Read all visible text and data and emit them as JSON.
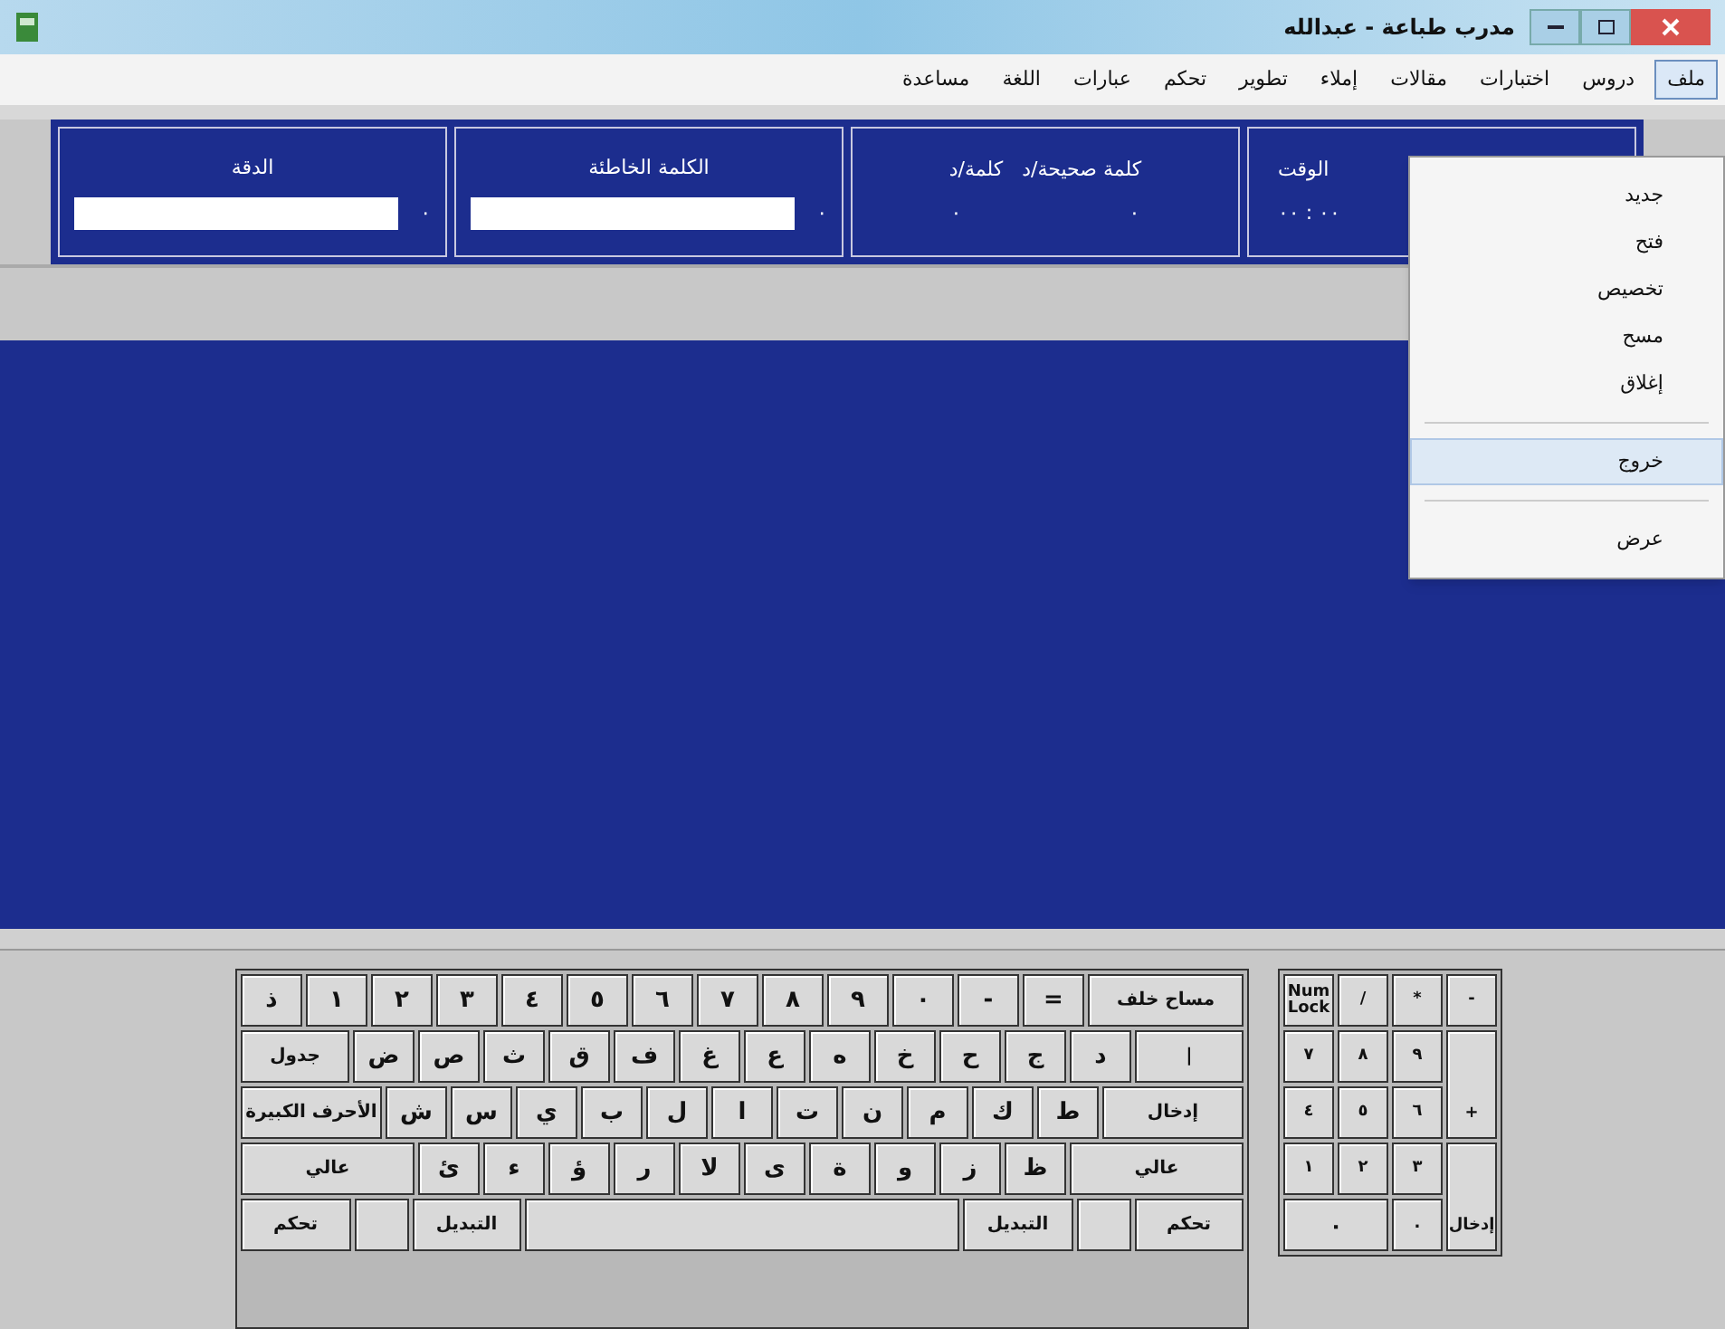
{
  "window": {
    "title": "مدرب طباعة - عبدالله"
  },
  "menu": [
    {
      "label": "ملف",
      "selected": true
    },
    {
      "label": "دروس",
      "selected": false
    },
    {
      "label": "اختبارات",
      "selected": false
    },
    {
      "label": "مقالات",
      "selected": false
    },
    {
      "label": "إملاء",
      "selected": false
    },
    {
      "label": "تطوير",
      "selected": false
    },
    {
      "label": "تحكم",
      "selected": false
    },
    {
      "label": "عبارات",
      "selected": false
    },
    {
      "label": "اللغة",
      "selected": false
    },
    {
      "label": "مساعدة",
      "selected": false
    }
  ],
  "dropdown": [
    {
      "kind": "item",
      "label": "جديد",
      "selected": false
    },
    {
      "kind": "item",
      "label": "فتح",
      "selected": false
    },
    {
      "kind": "item",
      "label": "تخصيص",
      "selected": false
    },
    {
      "kind": "item",
      "label": "مسح",
      "selected": false
    },
    {
      "kind": "item",
      "label": "إغلاق",
      "selected": false
    },
    {
      "kind": "separator"
    },
    {
      "kind": "item",
      "label": "خروج",
      "selected": true
    },
    {
      "kind": "separator"
    },
    {
      "kind": "item",
      "label": "عرض",
      "selected": false
    }
  ],
  "stats": [
    {
      "kind": "time",
      "label": "الوقت",
      "values": [
        "٠٠ : ٠٠"
      ]
    },
    {
      "kind": "pair",
      "label": "كلمة صحيحة/د   كلمة/د",
      "values": [
        "٠",
        "٠"
      ]
    },
    {
      "kind": "bar",
      "label": "الكلمة الخاطئة",
      "values": [
        "٠"
      ],
      "level": 1
    },
    {
      "kind": "bar",
      "label": "الدقة",
      "values": [
        "٠"
      ],
      "level": 1
    }
  ],
  "keyboard": {
    "number_row": [
      {
        "kind": "wide",
        "label": "مساح خلف"
      },
      {
        "kind": "char",
        "label": "="
      },
      {
        "kind": "char",
        "label": "-"
      },
      {
        "kind": "char",
        "label": "٠"
      },
      {
        "kind": "char",
        "label": "٩"
      },
      {
        "kind": "char",
        "label": "٨"
      },
      {
        "kind": "char",
        "label": "٧"
      },
      {
        "kind": "char",
        "label": "٦"
      },
      {
        "kind": "char",
        "label": "٥"
      },
      {
        "kind": "char",
        "label": "٤"
      },
      {
        "kind": "char",
        "label": "٣"
      },
      {
        "kind": "char",
        "label": "٢"
      },
      {
        "kind": "char",
        "label": "١"
      },
      {
        "kind": "char",
        "label": "ذ"
      }
    ],
    "top_row": [
      {
        "kind": "wide",
        "label": "|"
      },
      {
        "kind": "char",
        "label": "د"
      },
      {
        "kind": "char",
        "label": "ج"
      },
      {
        "kind": "char",
        "label": "ح"
      },
      {
        "kind": "char",
        "label": "خ"
      },
      {
        "kind": "char",
        "label": "ه"
      },
      {
        "kind": "char",
        "label": "ع"
      },
      {
        "kind": "char",
        "label": "غ"
      },
      {
        "kind": "char",
        "label": "ف"
      },
      {
        "kind": "char",
        "label": "ق"
      },
      {
        "kind": "char",
        "label": "ث"
      },
      {
        "kind": "char",
        "label": "ص"
      },
      {
        "kind": "char",
        "label": "ض"
      },
      {
        "kind": "wide",
        "label": "جدول"
      }
    ],
    "home_row": [
      {
        "kind": "wide",
        "label": "إدخال"
      },
      {
        "kind": "char",
        "label": "ط"
      },
      {
        "kind": "char",
        "label": "ك"
      },
      {
        "kind": "char",
        "label": "م"
      },
      {
        "kind": "char",
        "label": "ن"
      },
      {
        "kind": "char",
        "label": "ت"
      },
      {
        "kind": "char",
        "label": "ا"
      },
      {
        "kind": "char",
        "label": "ل"
      },
      {
        "kind": "char",
        "label": "ب"
      },
      {
        "kind": "char",
        "label": "ي"
      },
      {
        "kind": "char",
        "label": "س"
      },
      {
        "kind": "char",
        "label": "ش"
      },
      {
        "kind": "wide",
        "label": "الأحرف الكبيرة"
      }
    ],
    "bottom_row": [
      {
        "kind": "wide",
        "label": "عالي"
      },
      {
        "kind": "char",
        "label": "ظ"
      },
      {
        "kind": "char",
        "label": "ز"
      },
      {
        "kind": "char",
        "label": "و"
      },
      {
        "kind": "char",
        "label": "ة"
      },
      {
        "kind": "char",
        "label": "ى"
      },
      {
        "kind": "char",
        "label": "لا"
      },
      {
        "kind": "char",
        "label": "ر"
      },
      {
        "kind": "char",
        "label": "ؤ"
      },
      {
        "kind": "char",
        "label": "ء"
      },
      {
        "kind": "char",
        "label": "ئ"
      },
      {
        "kind": "wide",
        "label": "عالي"
      }
    ],
    "space_row": [
      {
        "kind": "wide",
        "label": "تحكم"
      },
      {
        "kind": "blank"
      },
      {
        "kind": "wide",
        "label": "التبديل"
      },
      {
        "kind": "space"
      },
      {
        "kind": "wide",
        "label": "التبديل"
      },
      {
        "kind": "blank"
      },
      {
        "kind": "wide",
        "label": "تحكم"
      }
    ],
    "numpad": [
      {
        "kind": "char",
        "label": "-"
      },
      {
        "kind": "char",
        "label": "*"
      },
      {
        "kind": "char",
        "label": "/"
      },
      {
        "kind": "char",
        "label": "Num Lock"
      },
      {
        "kind": "tall",
        "label": "+"
      },
      {
        "kind": "char",
        "label": "٩"
      },
      {
        "kind": "char",
        "label": "٨"
      },
      {
        "kind": "char",
        "label": "٧"
      },
      {
        "kind": "char",
        "label": "٦"
      },
      {
        "kind": "char",
        "label": "٥"
      },
      {
        "kind": "char",
        "label": "٤"
      },
      {
        "kind": "tall",
        "label": "إدخال"
      },
      {
        "kind": "char",
        "label": "٣"
      },
      {
        "kind": "char",
        "label": "٢"
      },
      {
        "kind": "char",
        "label": "١"
      },
      {
        "kind": "char",
        "label": "."
      },
      {
        "kind": "wide",
        "label": "٠"
      }
    ]
  }
}
